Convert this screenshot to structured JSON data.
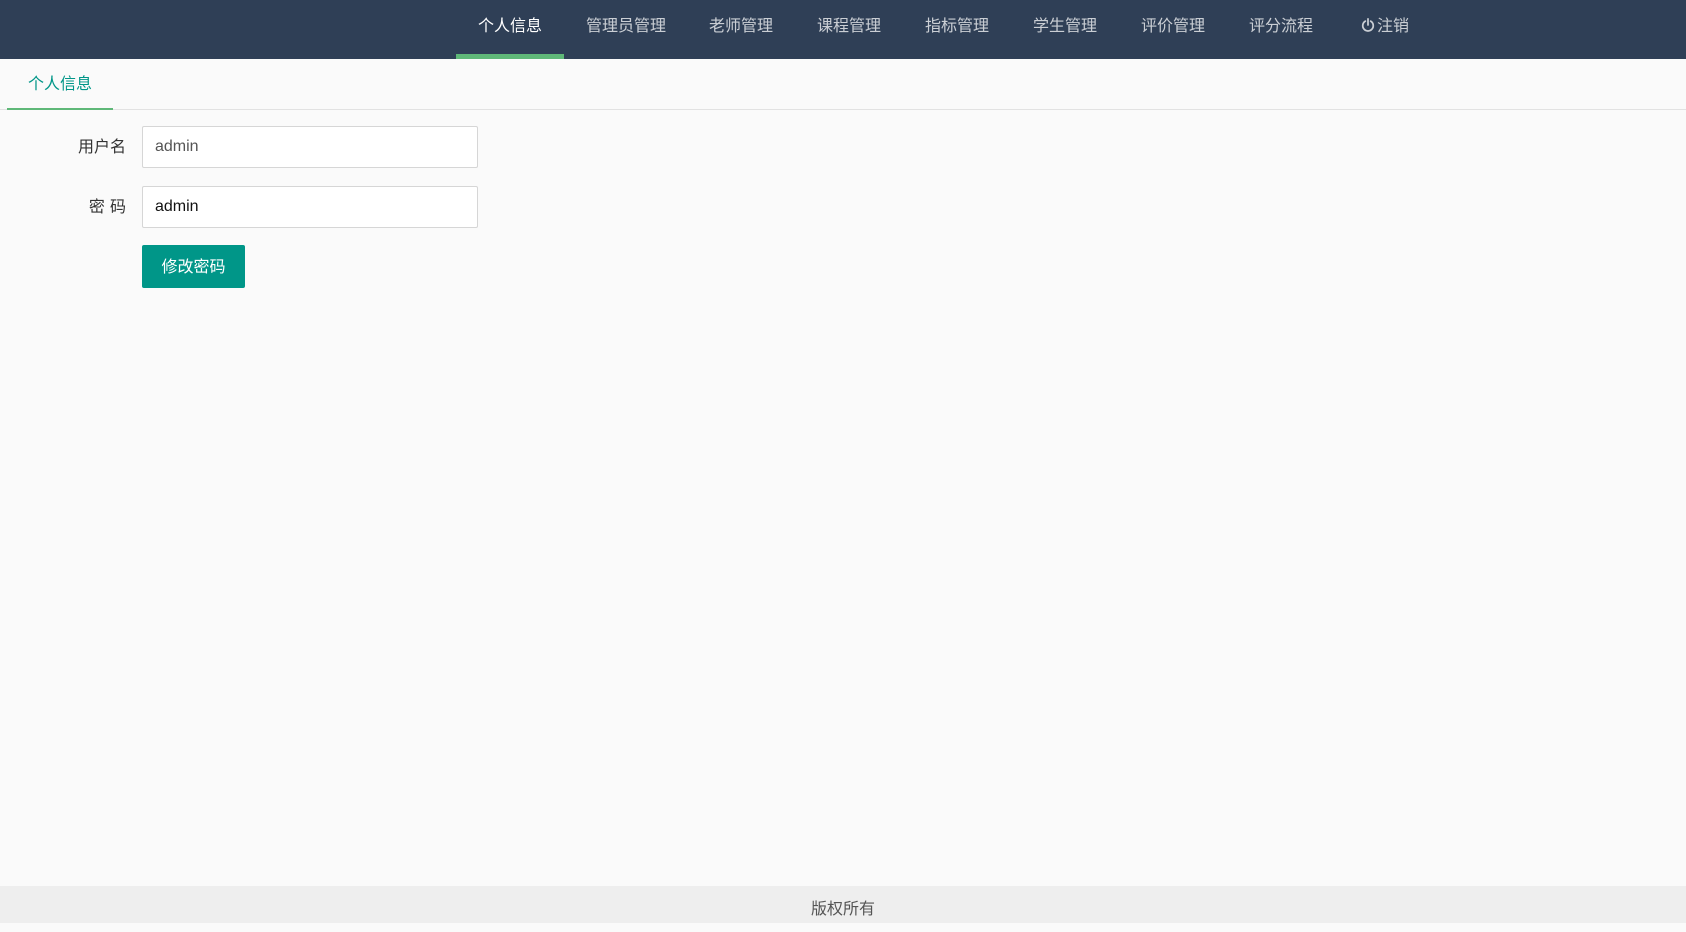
{
  "nav": {
    "items": [
      {
        "label": "个人信息",
        "active": true
      },
      {
        "label": "管理员管理"
      },
      {
        "label": "老师管理"
      },
      {
        "label": "课程管理"
      },
      {
        "label": "指标管理"
      },
      {
        "label": "学生管理"
      },
      {
        "label": "评价管理"
      },
      {
        "label": "评分流程"
      }
    ],
    "logout": {
      "label": "注销",
      "icon": "power-icon"
    }
  },
  "tabs": [
    {
      "label": "个人信息",
      "active": true
    }
  ],
  "form": {
    "username": {
      "label": "用户名",
      "value": "admin"
    },
    "password": {
      "label": "密 码",
      "value": "admin"
    },
    "submit_label": "修改密码"
  },
  "footer": {
    "text": "版权所有"
  },
  "colors": {
    "topbar": "#2f3f56",
    "accent": "#009688",
    "active_underline": "#5fb878"
  }
}
